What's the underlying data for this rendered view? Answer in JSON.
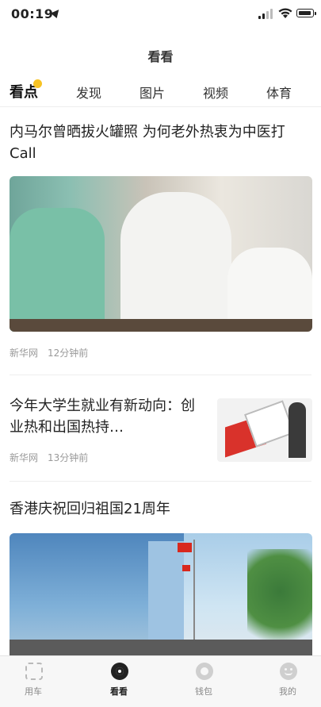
{
  "status_bar": {
    "time": "00:19"
  },
  "header": {
    "title": "看看"
  },
  "tabs": [
    {
      "label": "看点",
      "active": true
    },
    {
      "label": "发现"
    },
    {
      "label": "图片"
    },
    {
      "label": "视频"
    },
    {
      "label": "体育"
    }
  ],
  "articles": [
    {
      "title": "内马尔曾晒拔火罐照 为何老外热衷为中医打Call",
      "source": "新华网",
      "time": "12分钟前"
    },
    {
      "title": "今年大学生就业有新动向：创业热和出国热持…",
      "source": "新华网",
      "time": "13分钟前"
    },
    {
      "title": "香港庆祝回归祖国21周年"
    }
  ],
  "bottom_nav": [
    {
      "label": "用车",
      "icon": "scan-car-icon"
    },
    {
      "label": "看看",
      "icon": "eye-icon",
      "active": true
    },
    {
      "label": "钱包",
      "icon": "wallet-icon"
    },
    {
      "label": "我的",
      "icon": "profile-icon"
    }
  ],
  "colors": {
    "accent_dot": "#f7c323"
  }
}
